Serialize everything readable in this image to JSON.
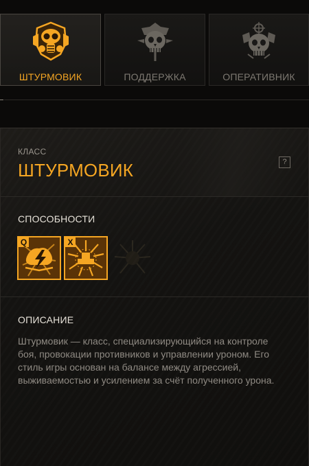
{
  "tabs": [
    {
      "label": "ШТУРМОВИК",
      "active": true,
      "icon": "gasmask-emblem-icon"
    },
    {
      "label": "ПОДДЕРЖКА",
      "active": false,
      "icon": "skull-caduceus-emblem-icon"
    },
    {
      "label": "ОПЕРАТИВНИК",
      "active": false,
      "icon": "skull-crosshair-emblem-icon"
    }
  ],
  "class_info": {
    "caption": "КЛАСС",
    "name": "ШТУРМОВИК",
    "help": "?"
  },
  "abilities": {
    "title": "СПОСОБНОСТИ",
    "items": [
      {
        "key": "Q",
        "icon": "lightning-burst-icon"
      },
      {
        "key": "X",
        "icon": "starburst-shield-icon"
      }
    ]
  },
  "description": {
    "title": "ОПИСАНИЕ",
    "text": "Штурмовик — класс, специализирующийся на контроле боя, провокации противников и управлении уроном. Его стиль игры основан на балансе между агрессией, выживаемостью и усилением за счёт полученного урона."
  },
  "colors": {
    "accent": "#f5a623",
    "inactive_text": "#7d7871",
    "background": "#0b0a09"
  }
}
